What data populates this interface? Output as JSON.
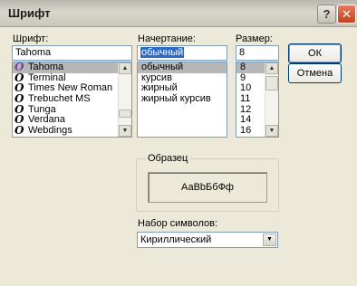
{
  "window": {
    "title": "Шрифт",
    "help_glyph": "?",
    "close_glyph": "✕"
  },
  "font": {
    "label": "Шрифт:",
    "value": "Tahoma",
    "items": [
      "Tahoma",
      "Terminal",
      "Times New Roman",
      "Trebuchet MS",
      "Tunga",
      "Verdana",
      "Webdings"
    ],
    "selected_index": 0,
    "icon_glyph": "O"
  },
  "style": {
    "label": "Начертание:",
    "value": "обычный",
    "items": [
      "обычный",
      "курсив",
      "жирный",
      "жирный курсив"
    ],
    "selected_index": 0
  },
  "size": {
    "label": "Размер:",
    "value": "8",
    "items": [
      "8",
      "9",
      "10",
      "11",
      "12",
      "14",
      "16"
    ],
    "selected_index": 0
  },
  "buttons": {
    "ok": "ОК",
    "cancel": "Отмена"
  },
  "sample": {
    "label": "Образец",
    "text": "АаВbБбФф"
  },
  "charset": {
    "label": "Набор символов:",
    "value": "Кириллический"
  },
  "icons": {
    "scroll_up": "▲",
    "scroll_down": "▼",
    "dropdown": "▼"
  },
  "colors": {
    "dialog_bg": "#ece9d8",
    "selection": "#316ac5",
    "list_selected": "#b7b7b7",
    "close_button": "#c3421f",
    "font_icon_selected": "#7b3da5"
  }
}
